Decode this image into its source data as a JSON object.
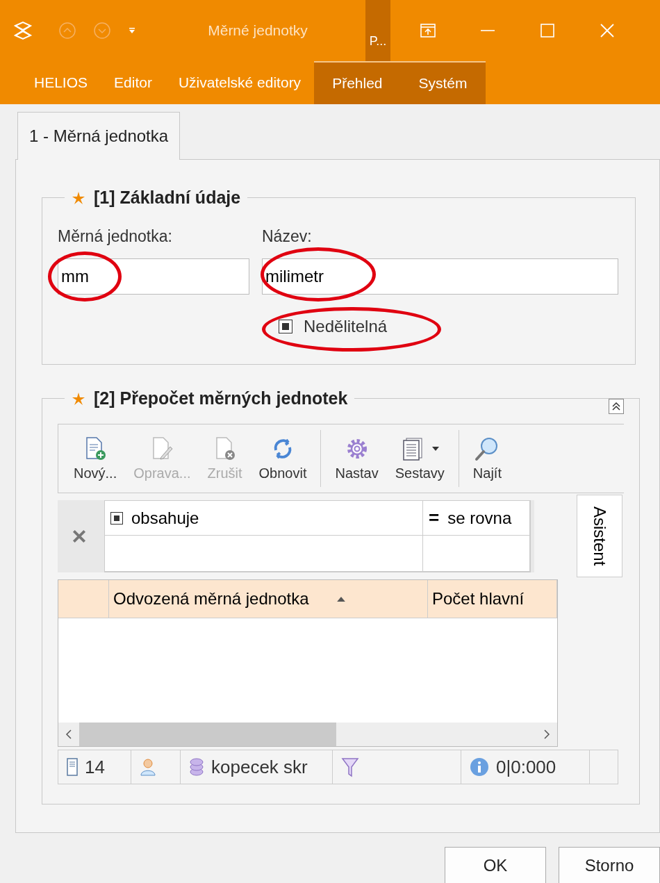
{
  "window": {
    "title": "Měrné jednotky",
    "pinned_tab": "P..."
  },
  "ribbon_tabs": [
    {
      "label": "HELIOS",
      "contextual": false
    },
    {
      "label": "Editor",
      "contextual": false
    },
    {
      "label": "Uživatelské editory",
      "contextual": false
    },
    {
      "label": "Přehled",
      "contextual": true
    },
    {
      "label": "Systém",
      "contextual": true
    }
  ],
  "page_tabs": [
    {
      "label": "1 - Měrná jednotka",
      "selected": true
    }
  ],
  "basic_group": {
    "title": "[1] Základní údaje",
    "fields": [
      {
        "label": "Měrná jednotka:",
        "value": "mm",
        "circled": true
      },
      {
        "label": "Název:",
        "value": "milimetr",
        "circled": true
      }
    ],
    "checkbox": {
      "label": "Nedělitelná",
      "indeterminate": true,
      "circled": true
    }
  },
  "conversion_group": {
    "title": "[2] Přepočet měrných jednotek",
    "toolbar": [
      {
        "kind": "new",
        "label": "Nový...",
        "disabled": false,
        "dropdown": false,
        "separator_before": false
      },
      {
        "kind": "edit",
        "label": "Oprava...",
        "disabled": true,
        "dropdown": false,
        "separator_before": false
      },
      {
        "kind": "delete",
        "label": "Zrušit",
        "disabled": true,
        "dropdown": false,
        "separator_before": false
      },
      {
        "kind": "refresh",
        "label": "Obnovit",
        "disabled": false,
        "dropdown": false,
        "separator_before": false
      },
      {
        "kind": "settings",
        "label": "Nastav",
        "disabled": false,
        "dropdown": false,
        "separator_before": true
      },
      {
        "kind": "reports",
        "label": "Sestavy",
        "disabled": false,
        "dropdown": true,
        "separator_before": false
      },
      {
        "kind": "search",
        "label": "Najít",
        "disabled": false,
        "dropdown": false,
        "separator_before": true
      }
    ],
    "filters": [
      {
        "kind": "icon",
        "label": "obsahuje"
      },
      {
        "kind": "symbol",
        "symbol": "=",
        "label": "se rovna"
      }
    ],
    "columns": [
      {
        "label": "Odvozená měrná jednotka",
        "sorted": true
      },
      {
        "label": "Počet hlavní",
        "sorted": false
      }
    ],
    "side_tab": "Asistent",
    "status_bar": {
      "count": "14",
      "user": "kopecek skr",
      "timing": "0|0:000"
    }
  },
  "buttons": [
    {
      "label": "OK"
    },
    {
      "label": "Storno"
    }
  ]
}
